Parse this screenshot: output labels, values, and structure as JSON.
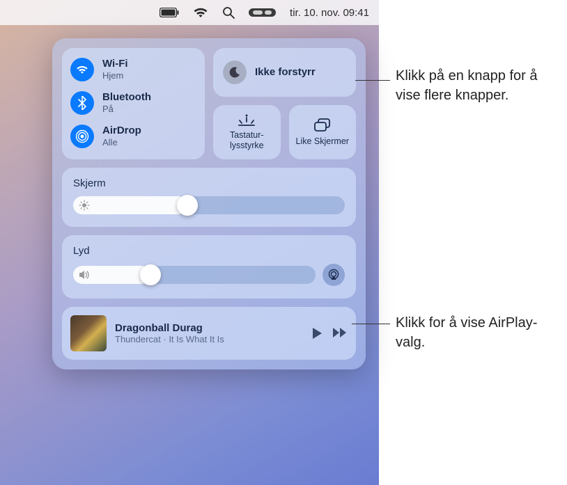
{
  "menubar": {
    "date_time": "tir. 10. nov. 09:41"
  },
  "callouts": {
    "dnd": "Klikk på en knapp for å vise flere knapper.",
    "airplay": "Klikk for å vise AirPlay-valg."
  },
  "controlcenter": {
    "connectivity": {
      "wifi": {
        "title": "Wi-Fi",
        "sub": "Hjem"
      },
      "bluetooth": {
        "title": "Bluetooth",
        "sub": "På"
      },
      "airdrop": {
        "title": "AirDrop",
        "sub": "Alle"
      }
    },
    "dnd": {
      "title": "Ikke forstyrr"
    },
    "keyboard_brightness": {
      "label": "Tastatur-lysstyrke"
    },
    "mirror": {
      "label": "Like Skjermer"
    },
    "display": {
      "label": "Skjerm",
      "value_pct": 42
    },
    "sound": {
      "label": "Lyd",
      "value_pct": 32
    },
    "nowplaying": {
      "track": "Dragonball Durag",
      "artist_album": "Thundercat · It Is What It Is"
    }
  }
}
